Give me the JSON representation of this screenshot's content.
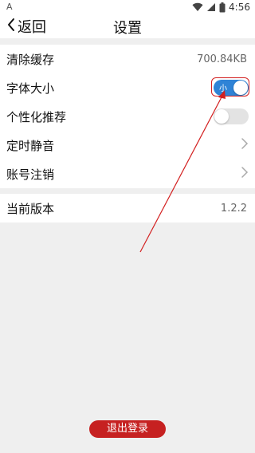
{
  "status_bar": {
    "left_glyph": "A",
    "time": "4:56",
    "icons": [
      "wifi-icon",
      "signal-icon",
      "battery-icon"
    ]
  },
  "nav": {
    "back_label": "返回",
    "title": "设置"
  },
  "settings": {
    "cache": {
      "label": "清除缓存",
      "value": "700.84KB"
    },
    "font_size": {
      "label": "字体大小",
      "toggle_text": "小",
      "on": true
    },
    "personalized": {
      "label": "个性化推荐",
      "on": false
    },
    "scheduled_mute": {
      "label": "定时静音"
    },
    "account_cancel": {
      "label": "账号注销"
    }
  },
  "version": {
    "label": "当前版本",
    "value": "1.2.2"
  },
  "logout_label": "退出登录",
  "colors": {
    "accent_blue": "#2f83d6",
    "logout_red": "#c62121",
    "annotation_red": "#d32020"
  }
}
